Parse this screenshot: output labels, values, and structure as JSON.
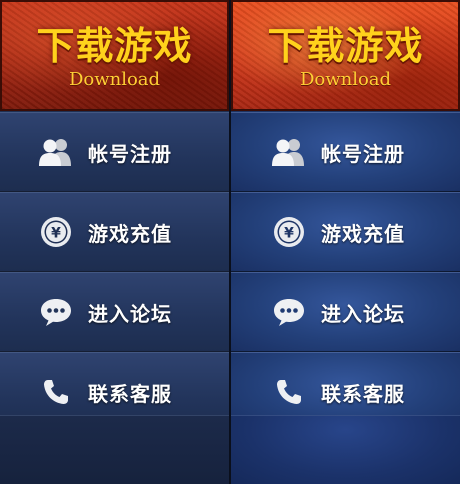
{
  "download": {
    "title": "下载游戏",
    "subtitle": "Download"
  },
  "menu": [
    {
      "label": "帐号注册",
      "icon": "users-icon"
    },
    {
      "label": "游戏充值",
      "icon": "yen-coin-icon"
    },
    {
      "label": "进入论坛",
      "icon": "speech-bubble-icon"
    },
    {
      "label": "联系客服",
      "icon": "phone-icon"
    }
  ],
  "colors": {
    "title_gold": "#ffd21c",
    "header_red": "#a82512",
    "header_red_hover": "#d4391a",
    "panel_blue": "#22345b",
    "panel_blue_hover": "#23407a",
    "label_white": "#ffffff"
  }
}
